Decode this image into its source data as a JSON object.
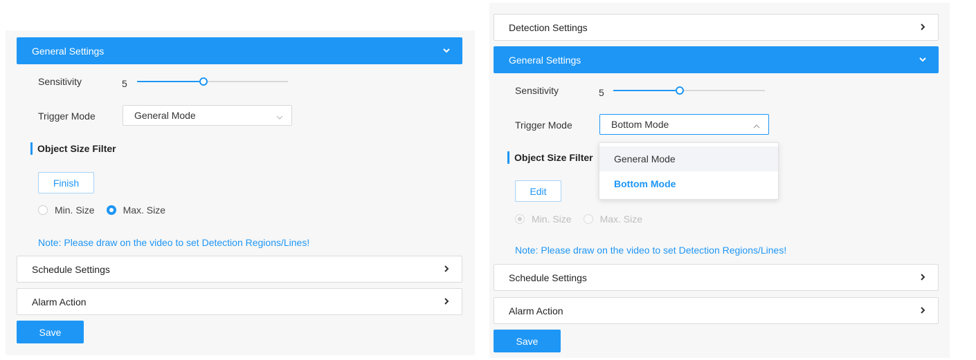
{
  "left": {
    "general_header": "General Settings",
    "sensitivity_label": "Sensitivity",
    "sensitivity_value": "5",
    "sensitivity_fraction": 0.44,
    "trigger_label": "Trigger Mode",
    "trigger_value": "General Mode",
    "object_filter_title": "Object Size Filter",
    "finish_button": "Finish",
    "min_size_label": "Min. Size",
    "max_size_label": "Max. Size",
    "selected_size": "max",
    "note": "Note: Please draw on the video to set Detection Regions/Lines!",
    "schedule_header": "Schedule Settings",
    "alarm_header": "Alarm Action",
    "save_button": "Save"
  },
  "right": {
    "detection_header": "Detection Settings",
    "general_header": "General Settings",
    "sensitivity_label": "Sensitivity",
    "sensitivity_value": "5",
    "sensitivity_fraction": 0.44,
    "trigger_label": "Trigger Mode",
    "trigger_value": "Bottom Mode",
    "dropdown_options": [
      "General Mode",
      "Bottom Mode"
    ],
    "object_filter_title": "Object Size Filter",
    "edit_button": "Edit",
    "min_size_label": "Min. Size",
    "max_size_label": "Max. Size",
    "selected_size": "min",
    "note": "Note: Please draw on the video to set Detection Regions/Lines!",
    "schedule_header": "Schedule Settings",
    "alarm_header": "Alarm Action",
    "save_button": "Save"
  },
  "colors": {
    "accent": "#1e96f5",
    "panel_bg": "#f7f7f7"
  },
  "icons": {
    "collapse": "chevron-down-icon",
    "expand": "chevron-right-icon",
    "select_closed": "caret-down-icon",
    "select_open": "caret-up-icon"
  }
}
